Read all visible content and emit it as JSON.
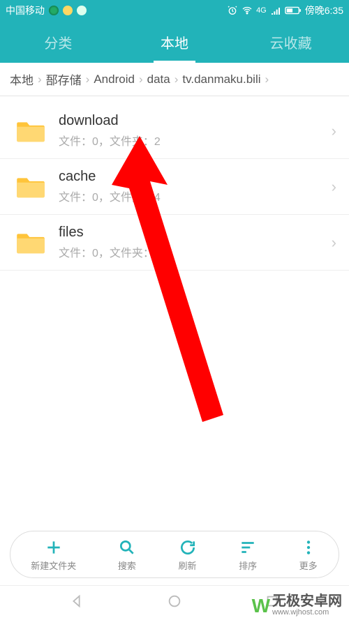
{
  "status": {
    "carrier": "中国移动",
    "time": "傍晚6:35",
    "network": "4G"
  },
  "tabs": [
    {
      "label": "分类"
    },
    {
      "label": "本地"
    },
    {
      "label": "云收藏"
    }
  ],
  "active_tab": 1,
  "breadcrumb": [
    "本地",
    "郚存储",
    "Android",
    "data",
    "tv.danmaku.bili"
  ],
  "folders": [
    {
      "name": "download",
      "sub": "文件：0，文件夹：2"
    },
    {
      "name": "cache",
      "sub": "文件：0，文件夹：4"
    },
    {
      "name": "files",
      "sub": "文件：0，文件夹：6"
    }
  ],
  "toolbar": [
    {
      "label": "新建文件夹",
      "icon": "plus"
    },
    {
      "label": "搜索",
      "icon": "search"
    },
    {
      "label": "刷新",
      "icon": "refresh"
    },
    {
      "label": "排序",
      "icon": "sort"
    },
    {
      "label": "更多",
      "icon": "more"
    }
  ],
  "watermark": {
    "brand": "W",
    "text": "无极安卓网",
    "url": "www.wjhost.com"
  },
  "colors": {
    "accent": "#22b3b9",
    "folder": "#ffc43a"
  }
}
